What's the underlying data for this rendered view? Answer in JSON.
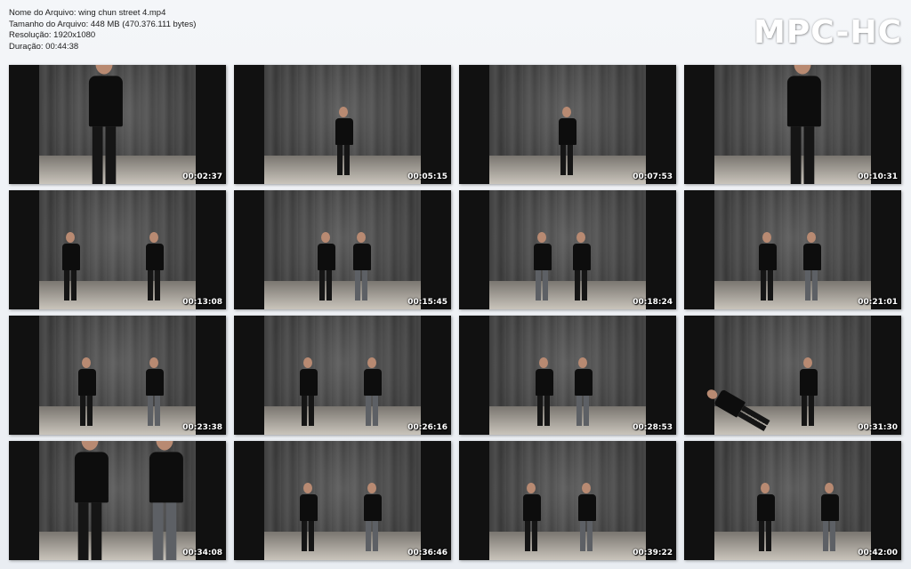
{
  "file_info": {
    "name_line": "Nome do Arquivo: wing chun street 4.mp4",
    "size_line": "Tamanho do Arquivo: 448 MB (470.376.111 bytes)",
    "resolution_line": "Resolução: 1920x1080",
    "duration_line": "Duração: 00:44:38"
  },
  "logo": "MPC-HC",
  "thumbnails": [
    {
      "time": "00:02:37"
    },
    {
      "time": "00:05:15"
    },
    {
      "time": "00:07:53"
    },
    {
      "time": "00:10:31"
    },
    {
      "time": "00:13:08"
    },
    {
      "time": "00:15:45"
    },
    {
      "time": "00:18:24"
    },
    {
      "time": "00:21:01"
    },
    {
      "time": "00:23:38"
    },
    {
      "time": "00:26:16"
    },
    {
      "time": "00:28:53"
    },
    {
      "time": "00:31:30"
    },
    {
      "time": "00:34:08"
    },
    {
      "time": "00:36:46"
    },
    {
      "time": "00:39:22"
    },
    {
      "time": "00:42:00"
    }
  ]
}
